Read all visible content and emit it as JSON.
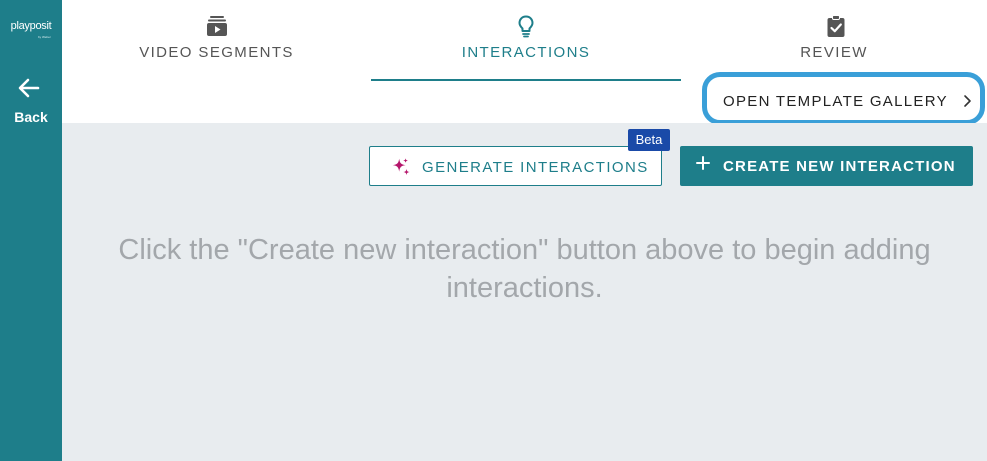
{
  "sidebar": {
    "logo": "playposit",
    "logo_sub": "by Weber",
    "back_label": "Back"
  },
  "tabs": [
    {
      "label": "VIDEO SEGMENTS",
      "icon": "video-stack-icon",
      "active": false
    },
    {
      "label": "INTERACTIONS",
      "icon": "lightbulb-icon",
      "active": true
    },
    {
      "label": "REVIEW",
      "icon": "clipboard-check-icon",
      "active": false
    }
  ],
  "gallery": {
    "label": "OPEN TEMPLATE GALLERY",
    "icon": "chevron-right-icon"
  },
  "actions": {
    "generate_label": "GENERATE INTERACTIONS",
    "generate_icon": "sparkle-icon",
    "beta_label": "Beta",
    "create_label": "CREATE NEW INTERACTION",
    "create_icon": "plus-icon"
  },
  "empty_message": "Click the \"Create new interaction\" button above to begin adding interactions.",
  "colors": {
    "primary": "#1e7e8a",
    "highlight_ring": "#3a9fd8",
    "beta_badge": "#1a4aa8",
    "sparkle": "#b5156b",
    "main_bg": "#e8ecef",
    "empty_text": "#a3a7ab"
  }
}
